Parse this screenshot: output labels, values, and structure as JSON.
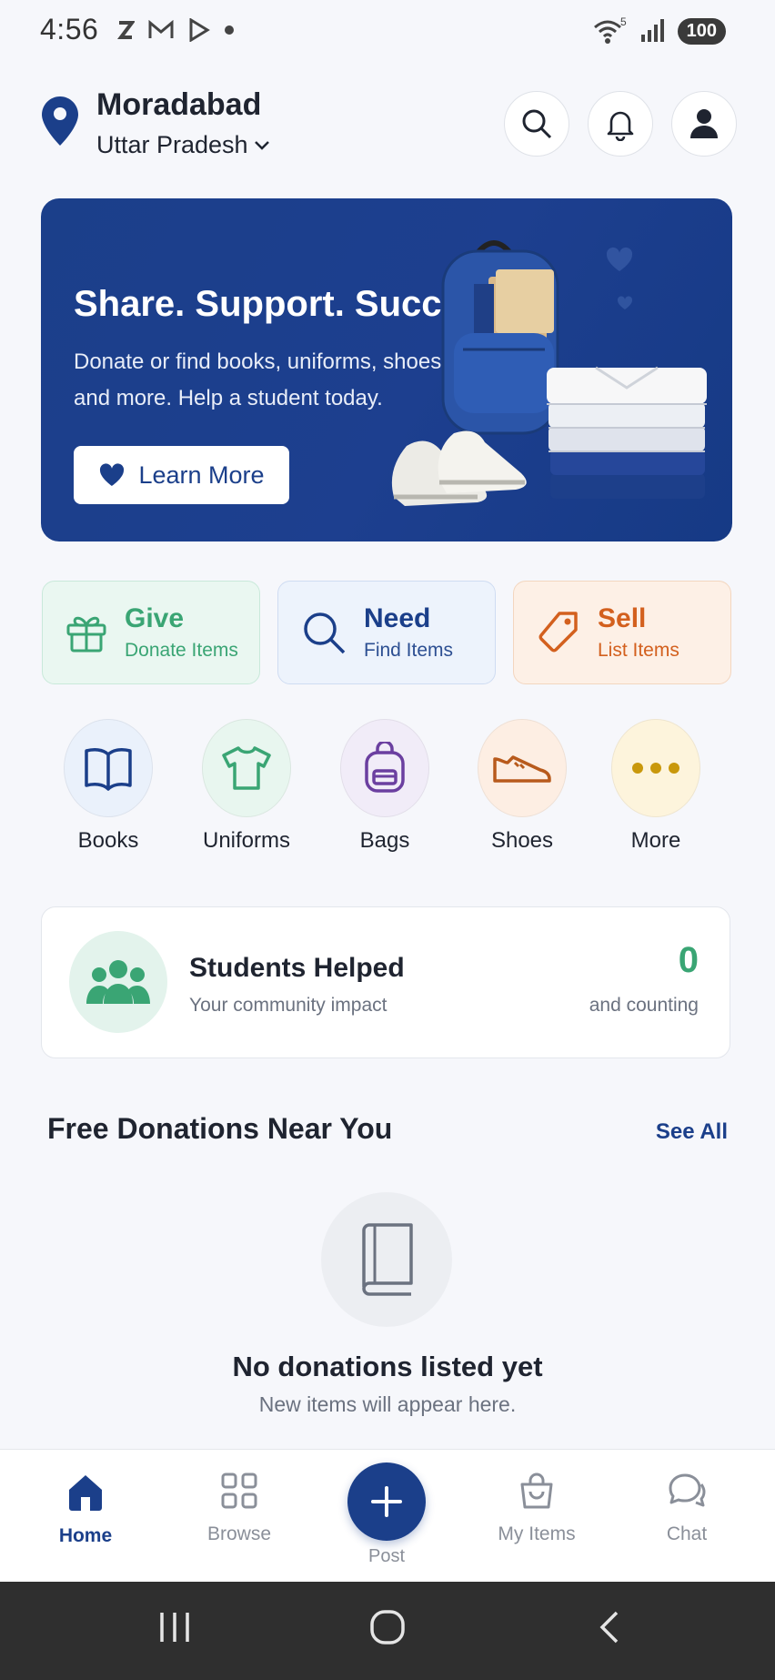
{
  "status_bar": {
    "time": "4:56",
    "left_icons": [
      "z-icon",
      "gmail-icon",
      "play-store-icon",
      "dot-icon"
    ],
    "right_icons": [
      "wifi-icon",
      "signal-icon"
    ],
    "wifi_badge": "5",
    "battery": "100"
  },
  "header": {
    "city": "Moradabad",
    "region": "Uttar Pradesh",
    "icons": [
      "search-icon",
      "bell-icon",
      "profile-icon"
    ]
  },
  "hero": {
    "title": "Share. Support. Succeed.",
    "subtitle": "Donate or find books, uniforms, shoes and more. Help a student today.",
    "button_label": "Learn More"
  },
  "actions": [
    {
      "title": "Give",
      "subtitle": "Donate Items",
      "icon": "gift-icon",
      "color": "#3aa574"
    },
    {
      "title": "Need",
      "subtitle": "Find Items",
      "icon": "search-icon",
      "color": "#1b3f8a"
    },
    {
      "title": "Sell",
      "subtitle": "List Items",
      "icon": "tag-icon",
      "color": "#d3601e"
    }
  ],
  "categories": [
    {
      "label": "Books",
      "icon": "book-icon",
      "bg": "#eaf1fb"
    },
    {
      "label": "Uniforms",
      "icon": "shirt-icon",
      "bg": "#e8f6ef"
    },
    {
      "label": "Bags",
      "icon": "backpack-icon",
      "bg": "#f1ecf8"
    },
    {
      "label": "Shoes",
      "icon": "shoe-icon",
      "bg": "#fdeee3"
    },
    {
      "label": "More",
      "icon": "more-icon",
      "bg": "#fdf4dc"
    }
  ],
  "impact": {
    "title": "Students Helped",
    "subtitle": "Your community impact",
    "count": "0",
    "count_sub": "and counting"
  },
  "donations": {
    "title": "Free Donations Near You",
    "see_all": "See All",
    "empty_title": "No donations listed yet",
    "empty_sub": "New items will appear here."
  },
  "bottom_nav": {
    "home": "Home",
    "browse": "Browse",
    "post": "Post",
    "my_items": "My Items",
    "chat": "Chat"
  },
  "colors": {
    "primary": "#1b3f8a",
    "green": "#3aa574",
    "orange": "#d3601e"
  }
}
